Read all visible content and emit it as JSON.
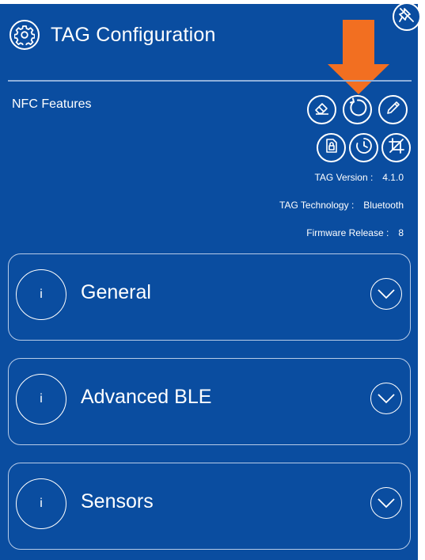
{
  "header": {
    "title": "TAG Configuration"
  },
  "nfc": {
    "label": "NFC Features"
  },
  "info": {
    "version_label": "TAG Version :",
    "version_value": "4.1.0",
    "technology_label": "TAG Technology :",
    "technology_value": "Bluetooth",
    "firmware_label": "Firmware Release :",
    "firmware_value": "8"
  },
  "sections": [
    {
      "title": "General",
      "info": "i"
    },
    {
      "title": "Advanced BLE",
      "info": "i"
    },
    {
      "title": "Sensors",
      "info": "i"
    }
  ],
  "colors": {
    "background": "#0a4da0",
    "foreground": "#ffffff",
    "arrow": "#f26f21"
  },
  "icons": [
    "gear-icon",
    "unpin-icon",
    "eraser-icon",
    "refresh-icon",
    "pencil-icon",
    "lock-file-icon",
    "history-icon",
    "crop-icon",
    "info-icon",
    "chevron-down-icon"
  ]
}
